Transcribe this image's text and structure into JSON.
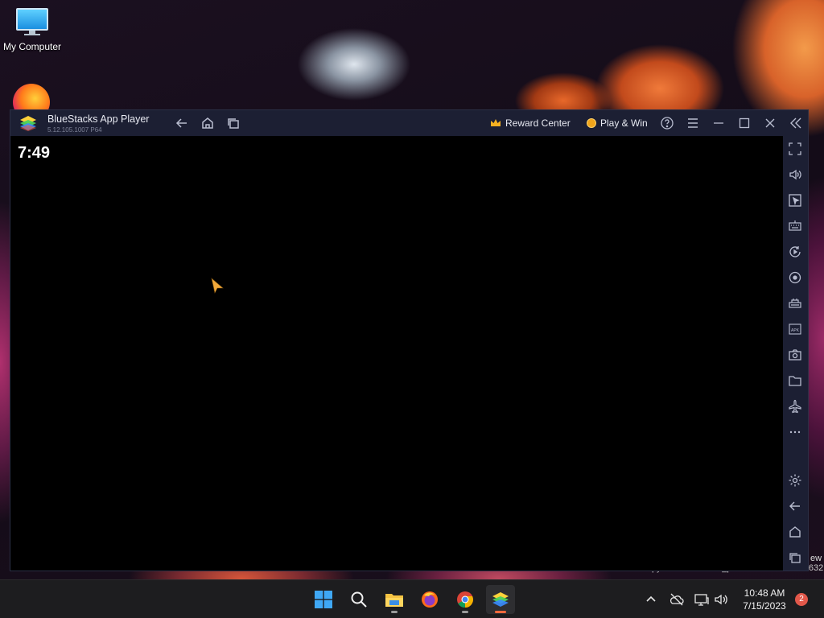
{
  "desktop": {
    "icons": [
      {
        "label": "My Computer",
        "icon": "monitor-icon"
      },
      {
        "label": "",
        "icon": "firefox-icon"
      }
    ],
    "watermark": "Evaluation copy. Build 25300.rs_prerelease.230203-1632",
    "watermark_side": "ew"
  },
  "app_window": {
    "title": "BlueStacks App Player",
    "version": "5.12.105.1007  P64",
    "toolbar": {
      "back_icon": "back-arrow-icon",
      "home_icon": "home-icon",
      "recents_icon": "recent-apps-icon",
      "reward_center_label": "Reward Center",
      "play_win_label": "Play & Win",
      "help_icon": "help-icon",
      "menu_icon": "hamburger-menu-icon",
      "minimize_icon": "minimize-icon",
      "maximize_icon": "maximize-icon",
      "close_icon": "close-icon",
      "collapse_icon": "collapse-sidebar-icon"
    },
    "screen": {
      "clock": "7:49"
    },
    "sidebar": [
      "fullscreen-icon",
      "volume-icon",
      "pointer-icon",
      "keyboard-icon",
      "rotate-icon",
      "sync-icon",
      "macro-icon",
      "apk-install-icon",
      "screenshot-icon",
      "folder-icon",
      "airplane-icon",
      "more-icon",
      "settings-icon",
      "android-back-icon",
      "android-home-icon",
      "android-recents-icon"
    ]
  },
  "taskbar": {
    "apps": [
      "windows-start-icon",
      "search-icon",
      "file-explorer-icon",
      "firefox-icon",
      "chrome-icon",
      "bluestacks-icon"
    ],
    "tray": [
      "chevron-up-icon",
      "onedrive-icon",
      "network-icon",
      "volume-icon"
    ],
    "time": "10:48 AM",
    "date": "7/15/2023",
    "notifications": "2"
  },
  "colors": {
    "titlebar": "#1c1f33",
    "taskbar": "#1d1d1f",
    "accent": "#ff6a3d",
    "badge": "#e2584a"
  }
}
